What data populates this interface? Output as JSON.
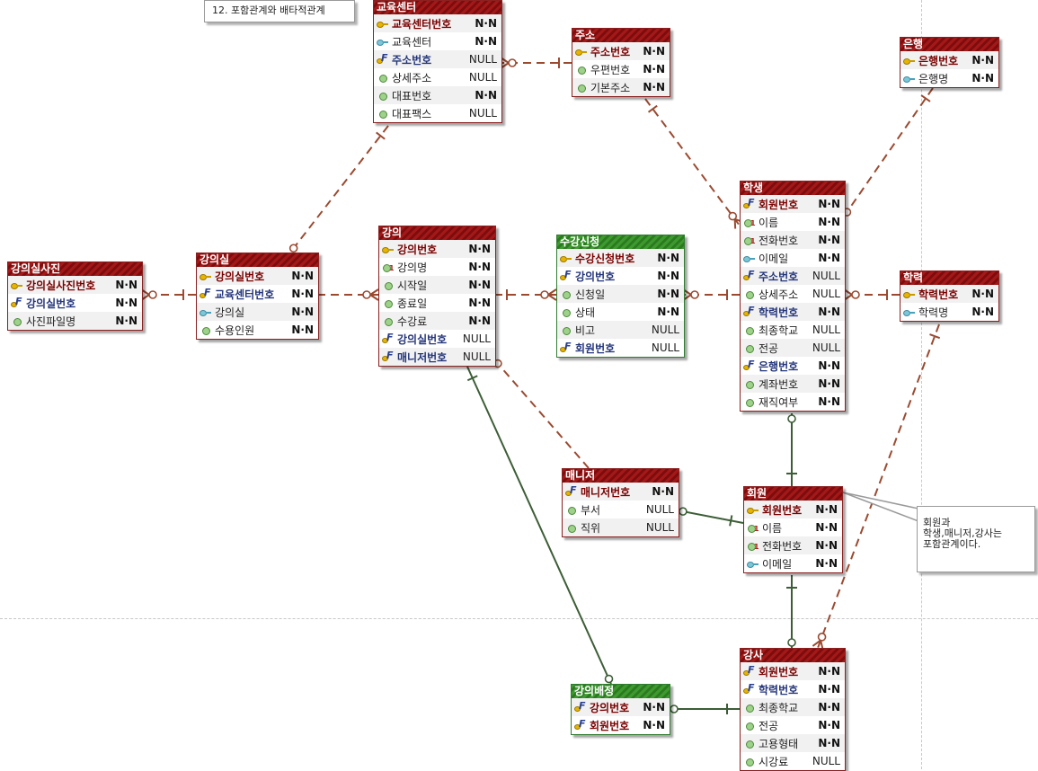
{
  "title_note": "12. 포함관계와 배타적관계",
  "side_note": "회원과\n학생,매니저,강사는\n포함관계이다.",
  "colors": {
    "entity": "#8b2020",
    "entity_green": "#2f7d2f",
    "relation_dashed": "#9b4a30",
    "relation_solid": "#3c5e36"
  },
  "entities": {
    "edu": {
      "title": "교육센터",
      "cols": [
        {
          "icon": "key",
          "name": "교육센터번호",
          "kind": "pk",
          "null": "N·N"
        },
        {
          "icon": "idx",
          "name": "교육센터",
          "kind": "",
          "null": "N·N"
        },
        {
          "icon": "fkey",
          "name": "주소번호",
          "kind": "fk",
          "null": "NULL"
        },
        {
          "icon": "attr",
          "name": "상세주소",
          "kind": "",
          "null": "NULL"
        },
        {
          "icon": "attr",
          "name": "대표번호",
          "kind": "",
          "null": "N·N"
        },
        {
          "icon": "attr",
          "name": "대표팩스",
          "kind": "",
          "null": "NULL"
        }
      ]
    },
    "addr": {
      "title": "주소",
      "cols": [
        {
          "icon": "key",
          "name": "주소번호",
          "kind": "pk",
          "null": "N·N"
        },
        {
          "icon": "attr",
          "name": "우편번호",
          "kind": "",
          "null": "N·N"
        },
        {
          "icon": "attr",
          "name": "기본주소",
          "kind": "",
          "null": "N·N"
        }
      ]
    },
    "bank": {
      "title": "은행",
      "cols": [
        {
          "icon": "key",
          "name": "은행번호",
          "kind": "pk",
          "null": "N·N"
        },
        {
          "icon": "idx",
          "name": "은행명",
          "kind": "",
          "null": "N·N"
        }
      ]
    },
    "photo": {
      "title": "강의실사진",
      "cols": [
        {
          "icon": "key",
          "name": "강의실사진번호",
          "kind": "pk",
          "null": "N·N"
        },
        {
          "icon": "fkey",
          "name": "강의실번호",
          "kind": "fk",
          "null": "N·N"
        },
        {
          "icon": "attr",
          "name": "사진파일명",
          "kind": "",
          "null": "N·N"
        }
      ]
    },
    "room": {
      "title": "강의실",
      "cols": [
        {
          "icon": "key",
          "name": "강의실번호",
          "kind": "pk",
          "null": "N·N"
        },
        {
          "icon": "fkey",
          "name": "교육센터번호",
          "kind": "fk",
          "null": "N·N"
        },
        {
          "icon": "idx",
          "name": "강의실",
          "kind": "",
          "null": "N·N"
        },
        {
          "icon": "attr",
          "name": "수용인원",
          "kind": "",
          "null": "N·N"
        }
      ]
    },
    "lecture": {
      "title": "강의",
      "cols": [
        {
          "icon": "key",
          "name": "강의번호",
          "kind": "pk",
          "null": "N·N"
        },
        {
          "icon": "uniq",
          "name": "강의명",
          "kind": "",
          "null": "N·N"
        },
        {
          "icon": "attr",
          "name": "시작일",
          "kind": "",
          "null": "N·N"
        },
        {
          "icon": "attr",
          "name": "종료일",
          "kind": "",
          "null": "N·N"
        },
        {
          "icon": "attr",
          "name": "수강료",
          "kind": "",
          "null": "N·N"
        },
        {
          "icon": "fkey",
          "name": "강의실번호",
          "kind": "fk",
          "null": "NULL"
        },
        {
          "icon": "fkey",
          "name": "매니저번호",
          "kind": "fk",
          "null": "NULL"
        }
      ]
    },
    "enroll": {
      "title": "수강신청",
      "cols": [
        {
          "icon": "key",
          "name": "수강신청번호",
          "kind": "pk",
          "null": "N·N"
        },
        {
          "icon": "fkey",
          "name": "강의번호",
          "kind": "fk",
          "null": "N·N"
        },
        {
          "icon": "attr",
          "name": "신청일",
          "kind": "",
          "null": "N·N"
        },
        {
          "icon": "attr",
          "name": "상태",
          "kind": "",
          "null": "N·N"
        },
        {
          "icon": "attr",
          "name": "비고",
          "kind": "",
          "null": "NULL"
        },
        {
          "icon": "fkey",
          "name": "회원번호",
          "kind": "fk",
          "null": "NULL"
        }
      ]
    },
    "student": {
      "title": "학생",
      "cols": [
        {
          "icon": "fkey",
          "name": "회원번호",
          "kind": "pkfk",
          "null": "N·N"
        },
        {
          "icon": "uniq",
          "name": "이름",
          "kind": "",
          "null": "N·N"
        },
        {
          "icon": "uniq",
          "name": "전화번호",
          "kind": "",
          "null": "N·N"
        },
        {
          "icon": "idx",
          "name": "이메일",
          "kind": "",
          "null": "N·N"
        },
        {
          "icon": "fkey",
          "name": "주소번호",
          "kind": "fk",
          "null": "NULL"
        },
        {
          "icon": "attr",
          "name": "상세주소",
          "kind": "",
          "null": "NULL"
        },
        {
          "icon": "fkey",
          "name": "학력번호",
          "kind": "fk",
          "null": "N·N"
        },
        {
          "icon": "attr",
          "name": "최종학교",
          "kind": "",
          "null": "NULL"
        },
        {
          "icon": "attr",
          "name": "전공",
          "kind": "",
          "null": "NULL"
        },
        {
          "icon": "fkey",
          "name": "은행번호",
          "kind": "fk",
          "null": "N·N"
        },
        {
          "icon": "attr",
          "name": "계좌번호",
          "kind": "",
          "null": "N·N"
        },
        {
          "icon": "attr",
          "name": "재직여부",
          "kind": "",
          "null": "N·N"
        }
      ]
    },
    "edulevel": {
      "title": "학력",
      "cols": [
        {
          "icon": "key",
          "name": "학력번호",
          "kind": "pk",
          "null": "N·N"
        },
        {
          "icon": "idx",
          "name": "학력명",
          "kind": "",
          "null": "N·N"
        }
      ]
    },
    "manager": {
      "title": "매니저",
      "cols": [
        {
          "icon": "fkey",
          "name": "매니저번호",
          "kind": "pkfk",
          "null": "N·N"
        },
        {
          "icon": "attr",
          "name": "부서",
          "kind": "",
          "null": "NULL"
        },
        {
          "icon": "attr",
          "name": "직위",
          "kind": "",
          "null": "NULL"
        }
      ]
    },
    "member": {
      "title": "회원",
      "cols": [
        {
          "icon": "key",
          "name": "회원번호",
          "kind": "pk",
          "null": "N·N"
        },
        {
          "icon": "uniq",
          "name": "이름",
          "kind": "",
          "null": "N·N"
        },
        {
          "icon": "uniq",
          "name": "전화번호",
          "kind": "",
          "null": "N·N"
        },
        {
          "icon": "idx",
          "name": "이메일",
          "kind": "",
          "null": "N·N"
        }
      ]
    },
    "assign": {
      "title": "강의배정",
      "cols": [
        {
          "icon": "fkey",
          "name": "강의번호",
          "kind": "pkfk",
          "null": "N·N"
        },
        {
          "icon": "fkey",
          "name": "회원번호",
          "kind": "pkfk",
          "null": "N·N"
        }
      ]
    },
    "teacher": {
      "title": "강사",
      "cols": [
        {
          "icon": "fkey",
          "name": "회원번호",
          "kind": "pkfk",
          "null": "N·N"
        },
        {
          "icon": "fkey",
          "name": "학력번호",
          "kind": "fk",
          "null": "N·N"
        },
        {
          "icon": "attr",
          "name": "최종학교",
          "kind": "",
          "null": "N·N"
        },
        {
          "icon": "attr",
          "name": "전공",
          "kind": "",
          "null": "N·N"
        },
        {
          "icon": "attr",
          "name": "고용형태",
          "kind": "",
          "null": "N·N"
        },
        {
          "icon": "attr",
          "name": "시강료",
          "kind": "",
          "null": "NULL"
        }
      ]
    }
  }
}
